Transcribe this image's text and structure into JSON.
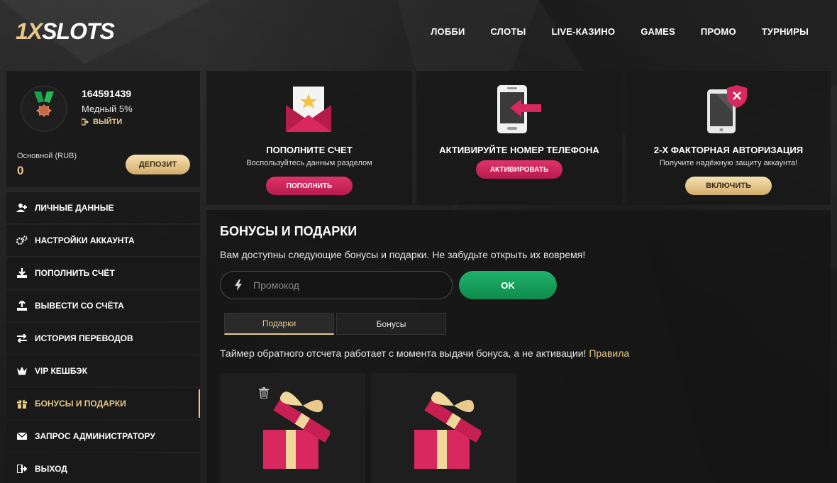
{
  "brand": {
    "logo_part1": "1X",
    "logo_part2": "SLOTS"
  },
  "nav": [
    "ЛОББИ",
    "СЛОТЫ",
    "LIVE-КАЗИНО",
    "GAMES",
    "ПРОМО",
    "ТУРНИРЫ"
  ],
  "profile": {
    "user_id": "164591439",
    "level": "Медный 5%",
    "logout": "ВЫЙТИ",
    "balance_label": "Основной (RUB)",
    "balance_value": "0",
    "deposit_button": "ДЕПОЗИТ"
  },
  "menu": [
    {
      "label": "ЛИЧНЫЕ ДАННЫЕ",
      "icon": "user-add-icon"
    },
    {
      "label": "НАСТРОЙКИ АККАУНТА",
      "icon": "gears-icon"
    },
    {
      "label": "ПОПОЛНИТЬ СЧЁТ",
      "icon": "download-icon"
    },
    {
      "label": "ВЫВЕСТИ СО СЧЁТА",
      "icon": "upload-icon"
    },
    {
      "label": "ИСТОРИЯ ПЕРЕВОДОВ",
      "icon": "transfer-icon"
    },
    {
      "label": "VIP КЕШБЭК",
      "icon": "crown-icon"
    },
    {
      "label": "БОНУСЫ И ПОДАРКИ",
      "icon": "gift-icon",
      "active": true
    },
    {
      "label": "ЗАПРОС АДМИНИСТРАТОРУ",
      "icon": "mail-icon"
    },
    {
      "label": "ВЫХОД",
      "icon": "exit-icon"
    }
  ],
  "cards": [
    {
      "title": "ПОПОЛНИТЕ СЧЕТ",
      "subtitle": "Воспользуйтесь данным разделом",
      "button": "ПОПОЛНИТЬ",
      "icon": "envelope-star-icon"
    },
    {
      "title": "АКТИВИРУЙТЕ НОМЕР ТЕЛЕФОНА",
      "subtitle": "",
      "button": "АКТИВИРОВАТЬ",
      "icon": "phone-arrow-icon"
    },
    {
      "title": "2-Х ФАКТОРНАЯ АВТОРИЗАЦИЯ",
      "subtitle": "Получите надёжную защиту аккаунта!",
      "button": "ВКЛЮЧИТЬ",
      "icon": "tablet-shield-icon"
    }
  ],
  "bonuses": {
    "title": "БОНУСЫ И ПОДАРКИ",
    "description": "Вам доступны следующие бонусы и подарки. Не забудьте открыть их вовремя!",
    "promo_placeholder": "Промокод",
    "ok_button": "OK",
    "tabs": [
      "Подарки",
      "Бонусы"
    ],
    "active_tab": "Подарки",
    "timer_text": "Таймер обратного отсчета работает с момента выдачи бонуса, а не активации!",
    "rules_link": "Правила"
  },
  "colors": {
    "gold": "#e9c98a",
    "pink": "#d12a5e",
    "green": "#159f58",
    "panel": "#191919"
  }
}
